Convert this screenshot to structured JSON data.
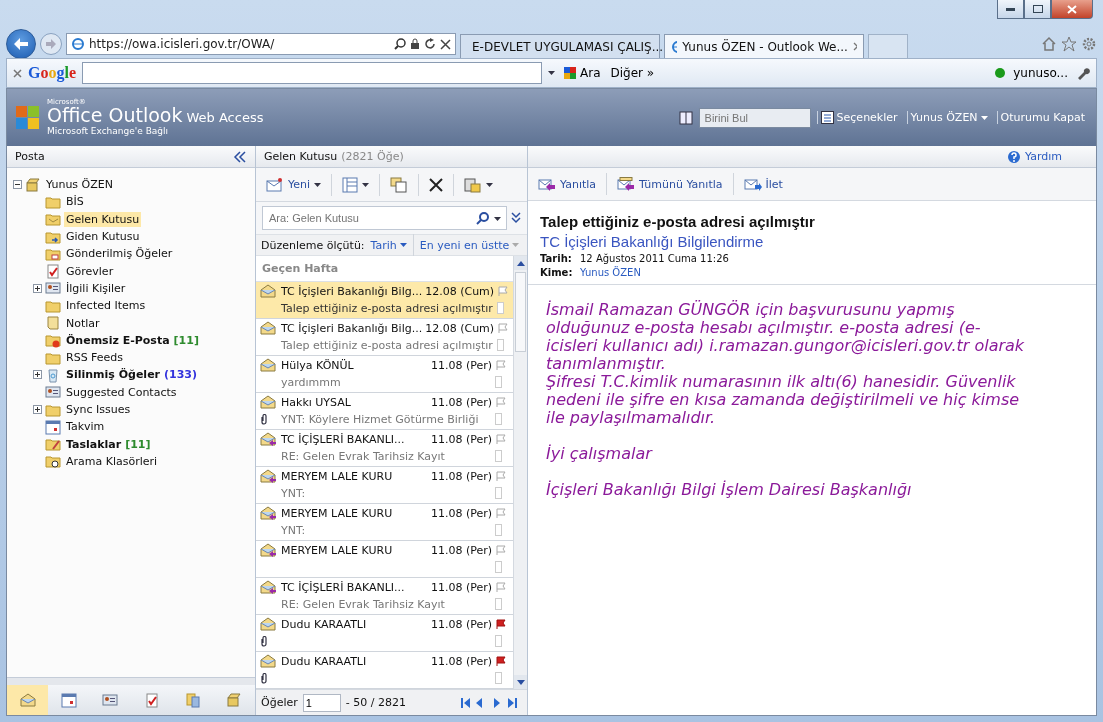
{
  "browser": {
    "url": "https://owa.icisleri.gov.tr/OWA/",
    "tabs": [
      {
        "title": "E-DEVLET UYGULAMASI ÇALIŞ...",
        "kind": "document",
        "selected": false
      },
      {
        "title": "Yunus ÖZEN - Outlook We...",
        "kind": "ie",
        "selected": true
      }
    ]
  },
  "google_toolbar": {
    "logo": "Google",
    "search_button": "Ara",
    "more": "Diğer »",
    "user": "yunuso..."
  },
  "header": {
    "brand_small": "Microsoft®",
    "brand": "Office Outlook",
    "brand_suffix": "Web Access",
    "subtitle": "Microsoft Exchange'e Bağlı",
    "find_placeholder": "Birini Bul",
    "options": "Seçenekler",
    "user": "Yunus ÖZEN",
    "logout": "Oturumu Kapat"
  },
  "folders": {
    "title": "Posta",
    "root": {
      "label": "Yunus ÖZEN",
      "kind": "mailbox",
      "expanded": true,
      "children": [
        {
          "label": "BİS",
          "kind": "folder",
          "selected": false,
          "bold": false
        },
        {
          "label": "Gelen Kutusu",
          "kind": "inbox",
          "selected": true,
          "bold": false
        },
        {
          "label": "Giden Kutusu",
          "kind": "outbox",
          "selected": false,
          "bold": false
        },
        {
          "label": "Gönderilmiş Öğeler",
          "kind": "sent",
          "selected": false,
          "bold": false
        },
        {
          "label": "Görevler",
          "kind": "tasks",
          "selected": false,
          "bold": false
        },
        {
          "label": "İlgili Kişiler",
          "kind": "contacts",
          "selected": false,
          "bold": false,
          "expanded": false
        },
        {
          "label": "Infected Items",
          "kind": "folder",
          "selected": false,
          "bold": false
        },
        {
          "label": "Notlar",
          "kind": "notes",
          "selected": false,
          "bold": false
        },
        {
          "label": "Önemsiz E-Posta",
          "kind": "junk",
          "selected": false,
          "bold": true,
          "count": "[11]",
          "unread": true
        },
        {
          "label": "RSS Feeds",
          "kind": "folder",
          "selected": false,
          "bold": false
        },
        {
          "label": "Silinmiş Öğeler",
          "kind": "deleted",
          "selected": false,
          "bold": true,
          "count": "(133)",
          "unread": false,
          "expanded": false
        },
        {
          "label": "Suggested Contacts",
          "kind": "contacts",
          "selected": false,
          "bold": false
        },
        {
          "label": "Sync Issues",
          "kind": "folder",
          "selected": false,
          "bold": false,
          "expanded": false
        },
        {
          "label": "Takvim",
          "kind": "calendar",
          "selected": false,
          "bold": false
        },
        {
          "label": "Taslaklar",
          "kind": "drafts",
          "selected": false,
          "bold": true,
          "count": "[11]",
          "unread": true
        },
        {
          "label": "Arama Klasörleri",
          "kind": "search",
          "selected": false,
          "bold": false
        }
      ]
    }
  },
  "nav_buttons": [
    {
      "kind": "mail",
      "selected": true
    },
    {
      "kind": "calendar",
      "selected": false
    },
    {
      "kind": "contacts",
      "selected": false
    },
    {
      "kind": "tasks",
      "selected": false
    },
    {
      "kind": "public",
      "selected": false
    },
    {
      "kind": "mailbox",
      "selected": false
    }
  ],
  "list": {
    "title": "Gelen Kutusu",
    "count": "(2821 Öğe)",
    "new_button": "Yeni",
    "search_placeholder": "Ara: Gelen Kutusu",
    "sort_label": "Düzenleme ölçütü:",
    "sort_by": "Tarih",
    "sort_order": "En yeni en üstte",
    "group": "Geçen Hafta",
    "messages": [
      {
        "sender": "TC İçişleri Bakanlığı Bilg...",
        "date": "12.08 (Cum)",
        "subject": "Talep ettiğiniz e-posta adresi açılmıştır",
        "kind": "read",
        "selected": true,
        "attachment": false,
        "flagged": false
      },
      {
        "sender": "TC İçişleri Bakanlığı Bilg...",
        "date": "12.08 (Cum)",
        "subject": "Talep ettiğiniz e-posta adresi açılmıştır",
        "kind": "read",
        "selected": false,
        "attachment": false,
        "flagged": false
      },
      {
        "sender": "Hülya KÖNÜL",
        "date": "11.08 (Per)",
        "subject": "yardımmm",
        "kind": "read",
        "selected": false,
        "attachment": false,
        "flagged": false
      },
      {
        "sender": "Hakkı UYSAL",
        "date": "11.08 (Per)",
        "subject": "YNT: Köylere Hizmet Götürme Birliği",
        "kind": "read",
        "selected": false,
        "attachment": true,
        "flagged": false
      },
      {
        "sender": "TC İÇİŞLERİ BAKANLI...",
        "date": "11.08 (Per)",
        "subject": "RE: Gelen Evrak Tarihsiz Kayıt",
        "kind": "replied",
        "selected": false,
        "attachment": false,
        "flagged": false
      },
      {
        "sender": "MERYEM LALE KURU",
        "date": "11.08 (Per)",
        "subject": "YNT:",
        "kind": "replied",
        "selected": false,
        "attachment": false,
        "flagged": false
      },
      {
        "sender": "MERYEM LALE KURU",
        "date": "11.08 (Per)",
        "subject": "YNT:",
        "kind": "replied",
        "selected": false,
        "attachment": false,
        "flagged": false
      },
      {
        "sender": "MERYEM LALE KURU",
        "date": "11.08 (Per)",
        "kind": "replied",
        "selected": false,
        "attachment": false,
        "flagged": false
      },
      {
        "sender": "TC İÇİŞLERİ BAKANLI...",
        "date": "11.08 (Per)",
        "subject": "RE: Gelen Evrak Tarihsiz Kayıt",
        "kind": "replied",
        "selected": false,
        "attachment": false,
        "flagged": false
      },
      {
        "sender": "Dudu KARAATLI",
        "date": "11.08 (Per)",
        "kind": "read",
        "selected": false,
        "attachment": true,
        "flagged": true
      },
      {
        "sender": "Dudu KARAATLI",
        "date": "11.08 (Per)",
        "kind": "read",
        "selected": false,
        "attachment": true,
        "flagged": true
      }
    ],
    "pager_label": "Öğeler",
    "pager_value": "1",
    "pager_range": "- 50 / 2821"
  },
  "reading": {
    "help": "Yardım",
    "actions": [
      {
        "label": "Yanıtla",
        "kind": "reply"
      },
      {
        "label": "Tümünü Yanıtla",
        "kind": "reply_all"
      },
      {
        "label": "İlet",
        "kind": "forward"
      }
    ],
    "subject": "Talep ettiğiniz e-posta adresi açılmıştır",
    "from": "TC İçişleri Bakanlığı Bilgilendirme",
    "date_label": "Tarih:",
    "date": "12 Ağustos 2011 Cuma 11:26",
    "to_label": "Kime:",
    "to": "Yunus ÖZEN",
    "body": [
      [
        "İsmail Ramazan GÜNGÖR için başvurusunu yapmış olduğunuz e-posta hesabı açılmıştır. e-posta adresi (e-icisleri kullanıcı adı) i.ramazan.gungor@icisleri.gov.tr olarak tanımlanmıştır.",
        "Şifresi T.C.kimlik numarasının ilk altı(6) hanesidir. Güvenlik nedeni ile şifre en kısa zamanda değiştirilmeli ve hiç kimse ile paylaşılmamalıdır."
      ],
      [
        "İyi çalışmalar"
      ],
      [
        "İçişleri Bakanlığı Bilgi İşlem Dairesi Başkanlığı"
      ]
    ]
  }
}
